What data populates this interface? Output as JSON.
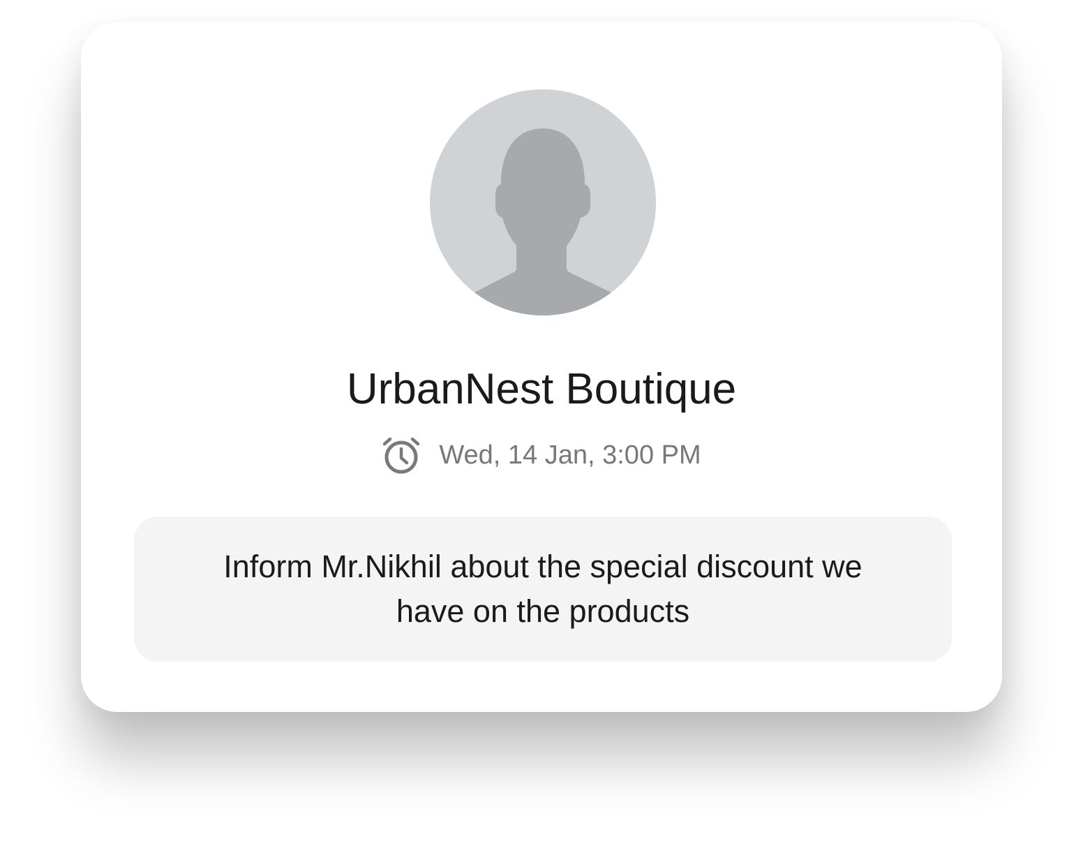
{
  "contact": {
    "name": "UrbanNest Boutique",
    "avatar_icon": "default-person-avatar-icon"
  },
  "reminder": {
    "icon": "alarm-clock-icon",
    "datetime": "Wed, 14 Jan, 3:00 PM",
    "note": "Inform Mr.Nikhil about the special discount we have on the products"
  },
  "colors": {
    "card_background": "#ffffff",
    "avatar_background": "#d0d3d6",
    "avatar_silhouette": "#a7aaad",
    "note_background": "#f4f4f4",
    "muted_text": "#777777",
    "primary_text": "#1a1a1a"
  }
}
